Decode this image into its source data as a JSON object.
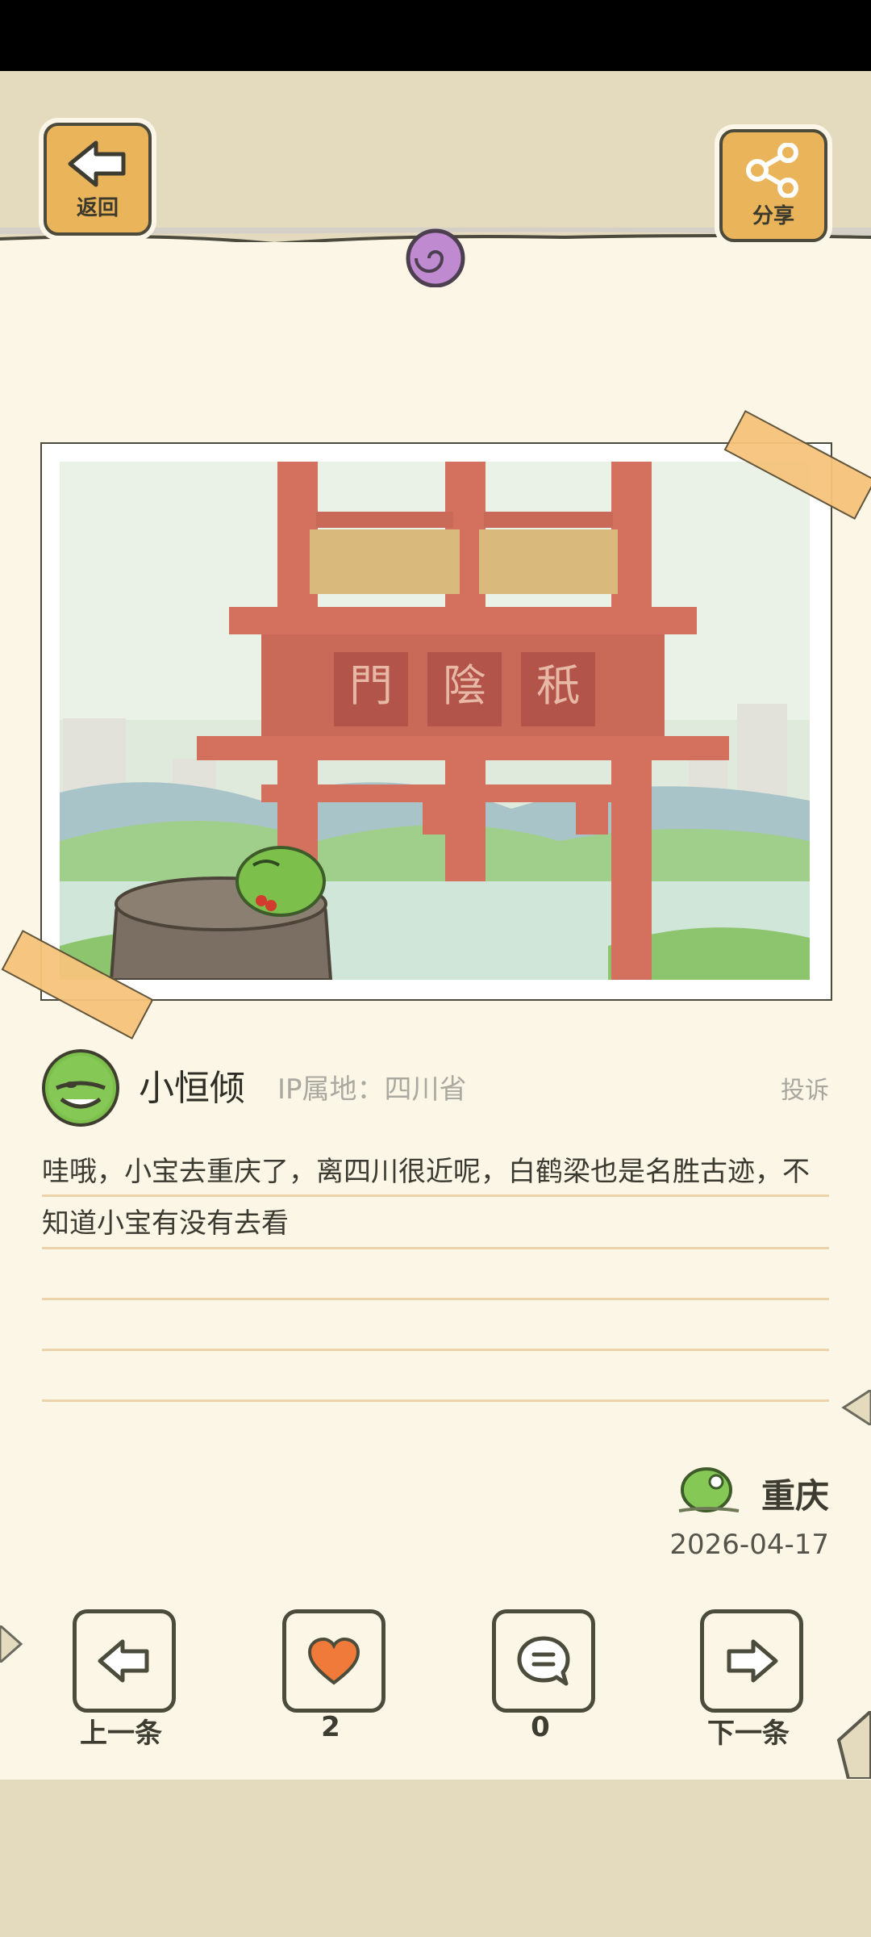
{
  "header": {
    "back_label": "返回",
    "share_label": "分享"
  },
  "post": {
    "username": "小恒倾",
    "ip_location": "IP属地：四川省",
    "report_label": "投诉",
    "content": "哇哦，小宝去重庆了，离四川很近呢，白鹤梁也是名胜古迹，不知道小宝有没有去看",
    "location": "重庆",
    "date": "2026-04-17",
    "photo": {
      "signboard_chars": [
        "門",
        "陰",
        "秖"
      ]
    }
  },
  "bottom_nav": {
    "prev_label": "上一条",
    "like_count": "2",
    "comment_count": "0",
    "next_label": "下一条"
  },
  "colors": {
    "paper": "#fcf6e6",
    "background": "#e4dbbf",
    "wood": "#e9b45a",
    "heart": "#f07a3a",
    "frog": "#7cbf4b"
  }
}
